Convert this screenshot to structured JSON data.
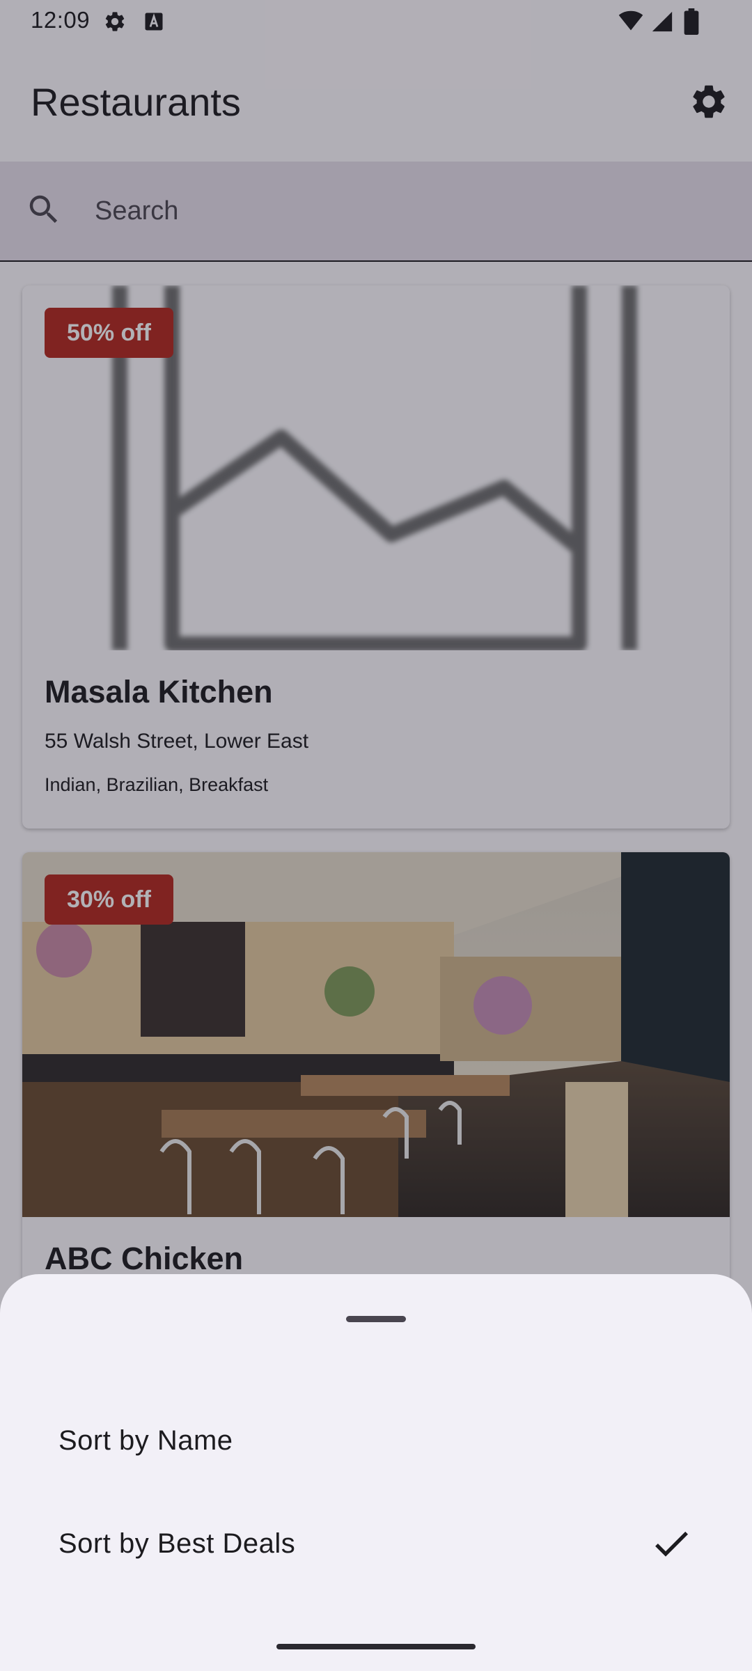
{
  "status": {
    "time": "12:09"
  },
  "header": {
    "title": "Restaurants"
  },
  "search": {
    "placeholder": "Search"
  },
  "restaurants": [
    {
      "name": "Masala Kitchen",
      "address": "55 Walsh Street, Lower East",
      "cuisine": "Indian, Brazilian, Breakfast",
      "deal": "50% off",
      "image": "image-placeholder"
    },
    {
      "name": "ABC Chicken",
      "deal": "30% off",
      "image": "restaurant-interior-photo"
    }
  ],
  "sort_sheet": {
    "options": [
      {
        "label": "Sort by Name",
        "selected": false
      },
      {
        "label": "Sort by Best Deals",
        "selected": true
      }
    ]
  },
  "colors": {
    "badge": "#b3261e",
    "sheet": "#f2f0f7",
    "scrim": "rgba(30,28,40,0.34)"
  }
}
